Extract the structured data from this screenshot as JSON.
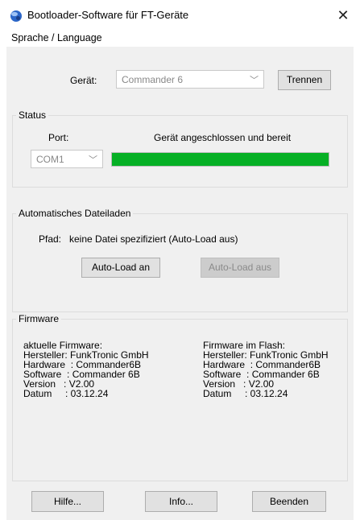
{
  "window": {
    "title": "Bootloader-Software für FT-Geräte",
    "close_glyph": "✕",
    "app_icon": "blue-orb-icon"
  },
  "menu": {
    "items": [
      {
        "label": "Sprache / Language"
      }
    ]
  },
  "device": {
    "label": "Gerät:",
    "selected": "Commander 6",
    "disconnect_label": "Trennen"
  },
  "status": {
    "group_title": "Status",
    "port_label": "Port:",
    "port_value": "COM1",
    "message": "Gerät angeschlossen und bereit",
    "progress": 1.0,
    "progress_color": "#06b025"
  },
  "autoload": {
    "group_title": "Automatisches Dateiladen",
    "path_label": "Pfad:",
    "path_value": "keine Datei spezifiziert (Auto-Load aus)",
    "on_label": "Auto-Load an",
    "off_label": "Auto-Load aus"
  },
  "firmware": {
    "group_title": "Firmware",
    "current": {
      "title": "aktuelle Firmware:",
      "manufacturer": "Hersteller: FunkTronic GmbH",
      "hardware": "Hardware  : Commander6B",
      "software": "Software  : Commander 6B",
      "version": "Version   : V2.00",
      "date": "Datum     : 03.12.24"
    },
    "flash": {
      "title": "Firmware im Flash:",
      "manufacturer": "Hersteller: FunkTronic GmbH",
      "hardware": "Hardware  : Commander6B",
      "software": "Software  : Commander 6B",
      "version": "Version   : V2.00",
      "date": "Datum     : 03.12.24"
    }
  },
  "footer": {
    "help_label": "Hilfe...",
    "info_label": "Info...",
    "exit_label": "Beenden"
  }
}
